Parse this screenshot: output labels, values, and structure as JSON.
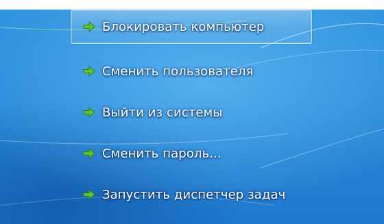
{
  "menu": {
    "items": [
      {
        "label": "Блокировать компьютер",
        "icon": "green-arrow-icon",
        "selected": true
      },
      {
        "label": "Сменить пользователя",
        "icon": "green-arrow-icon",
        "selected": false
      },
      {
        "label": "Выйти из системы",
        "icon": "green-arrow-icon",
        "selected": false
      },
      {
        "label": "Сменить пароль...",
        "icon": "green-arrow-icon",
        "selected": false
      },
      {
        "label": "Запустить диспетчер задач",
        "icon": "green-arrow-icon",
        "selected": false
      }
    ]
  },
  "colors": {
    "background": "#2a8ad8",
    "text": "#ffffff",
    "arrow": "#5cc52e",
    "selection_border": "#d2ebff"
  }
}
